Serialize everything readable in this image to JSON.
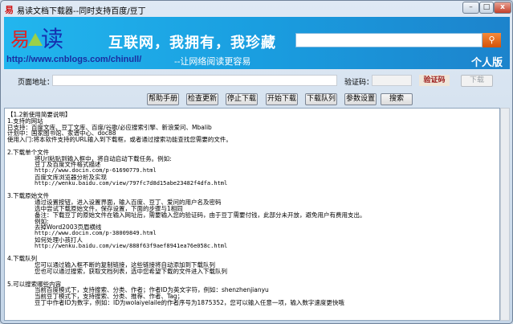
{
  "window": {
    "title": "易读文档下载器--同时支持百度/豆丁",
    "minimize": "–",
    "maximize": "□",
    "close": "x"
  },
  "banner": {
    "logo_text": "易读",
    "url": "http://www.cnblogs.com/chinull/",
    "slogan": "互联网，我拥有，我珍藏",
    "subslogan": "--让网络阅读更容易",
    "edition": "个人版",
    "search_value": "",
    "search_icon": "magnifier-icon"
  },
  "form": {
    "url_label": "页面地址：",
    "url_value": "",
    "captcha_label": "验证码：",
    "captcha_value": "",
    "captcha_image_text": "验证码",
    "download": "下载"
  },
  "toolbar": [
    "帮助手册",
    "检查更新",
    "停止下载",
    "开始下载",
    "下载队列",
    "参数设置",
    "搜索"
  ],
  "content": [
    {
      "t": "【1.2新使用简要说明】"
    },
    {
      "t": "1.支持的网站"
    },
    {
      "t": "已支持：百度文库、豆丁文库、百度/谷歌/必应搜索引擎、新浪爱问、Mbalib"
    },
    {
      "t": "计划中：国家图书馆、家谱中心、doc88"
    },
    {
      "t": "使用入门:将本软件支持的URL输入到下载框，或者通过搜索功能查找您需要的文件。"
    },
    {
      "t": ""
    },
    {
      "t": "2.下载单个文件"
    },
    {
      "t": "将Url粘贴到输入框中，将自动启动下载任务。例如:",
      "i": 1
    },
    {
      "t": "豆丁及百度文件格式描述",
      "i": 1
    },
    {
      "t": "http://www.docin.com/p-61690779.html",
      "i": 1,
      "m": 1
    },
    {
      "t": "百度文库浏览器分析及实现",
      "i": 1
    },
    {
      "t": "http://wenku.baidu.com/view/797fc7d8d15abe23482f4dfa.html",
      "i": 1,
      "m": 1
    },
    {
      "t": ""
    },
    {
      "t": "3.下载原始文件"
    },
    {
      "t": "通过设置按钮，进入设置界面，输入百度、豆丁、爱问的用户名及密码",
      "i": 1
    },
    {
      "t": "选中尝试下载原始文件，保存设置，下面的步骤与1相同",
      "i": 1
    },
    {
      "t": "备注：下载豆丁的原始文件在输入网址后，需要输入您的验证码，由于豆丁需要付钱，此部分未开放，避免用户有费用支出。",
      "i": 1
    },
    {
      "t": "例如:",
      "i": 1
    },
    {
      "t": "去掉Word2003页眉横线",
      "i": 1
    },
    {
      "t": "http://www.docin.com/p-38009849.html",
      "i": 1,
      "m": 1
    },
    {
      "t": "如何处理小孩打人",
      "i": 1
    },
    {
      "t": "http://wenku.baidu.com/view/888f63f9aef8941ea76e058c.html",
      "i": 1,
      "m": 1
    },
    {
      "t": ""
    },
    {
      "t": "4.下载队列"
    },
    {
      "t": "您可以通过输入框不断的复制链接，这些链接将自动添加到下载队列",
      "i": 1
    },
    {
      "t": "您也可以通过搜索，获取文档列表，选中您希望下载的文件进入下载队列",
      "i": 1
    },
    {
      "t": ""
    },
    {
      "t": "5.可以搜索哪些内容"
    },
    {
      "t": "当前百度模式下，支持搜索、分类、作者；作者ID为英文字符，例如：shenzhenjianyu",
      "i": 1
    },
    {
      "t": "当前豆丁模式下，支持搜索、分类、推荐、作者、Tag；",
      "i": 1
    },
    {
      "t": "豆丁中作者ID为数字，例如：ID为wolaiyelaile的作者序号为1875352，您可以输入任意一项，输入数字速度更快哦",
      "i": 1
    }
  ]
}
